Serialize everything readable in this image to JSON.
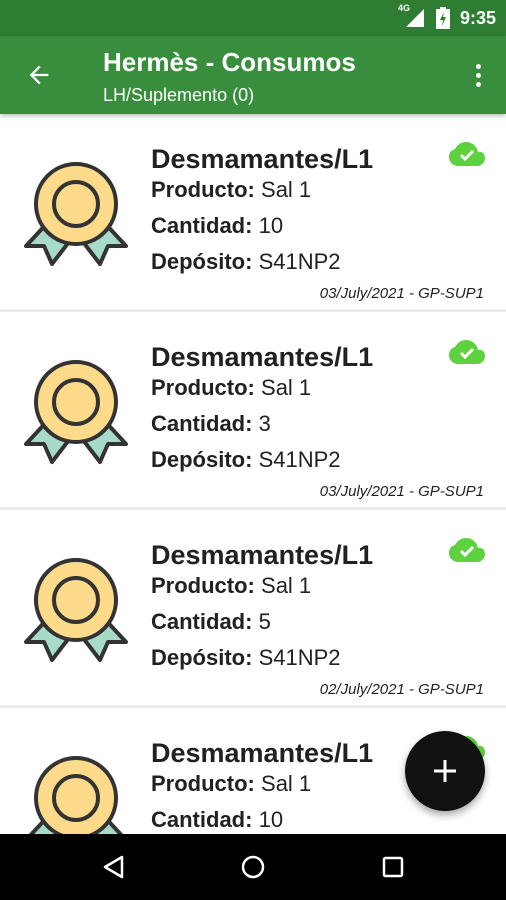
{
  "status_bar": {
    "network": "4G",
    "time": "9:35"
  },
  "app_bar": {
    "title": "Hermès - Consumos",
    "subtitle": "LH/Suplemento (0)"
  },
  "labels": {
    "producto": "Producto:",
    "cantidad": "Cantidad:",
    "deposito": "Depósito:"
  },
  "items": [
    {
      "title": "Desmamantes/L1",
      "producto": "Sal 1",
      "cantidad": "10",
      "deposito": "S41NP2",
      "footer": "03/July/2021 - GP-SUP1",
      "synced": true
    },
    {
      "title": "Desmamantes/L1",
      "producto": "Sal 1",
      "cantidad": "3",
      "deposito": "S41NP2",
      "footer": "03/July/2021 - GP-SUP1",
      "synced": true
    },
    {
      "title": "Desmamantes/L1",
      "producto": "Sal 1",
      "cantidad": "5",
      "deposito": "S41NP2",
      "footer": "02/July/2021 - GP-SUP1",
      "synced": true
    },
    {
      "title": "Desmamantes/L1",
      "producto": "Sal 1",
      "cantidad": "10",
      "deposito": "",
      "footer": "",
      "synced": true
    }
  ],
  "colors": {
    "primary": "#388e3c",
    "primary_dark": "#2e7d32",
    "sync_green": "#5ed13f",
    "fab": "#111111",
    "medal_gold": "#fddb8a",
    "medal_ribbon": "#a8dac9",
    "outline": "#333333"
  },
  "icons": {
    "medal": "award-medal-icon",
    "sync": "cloud-done-icon",
    "add": "plus-icon",
    "back": "arrow-back-icon",
    "menu": "more-vert-icon"
  }
}
